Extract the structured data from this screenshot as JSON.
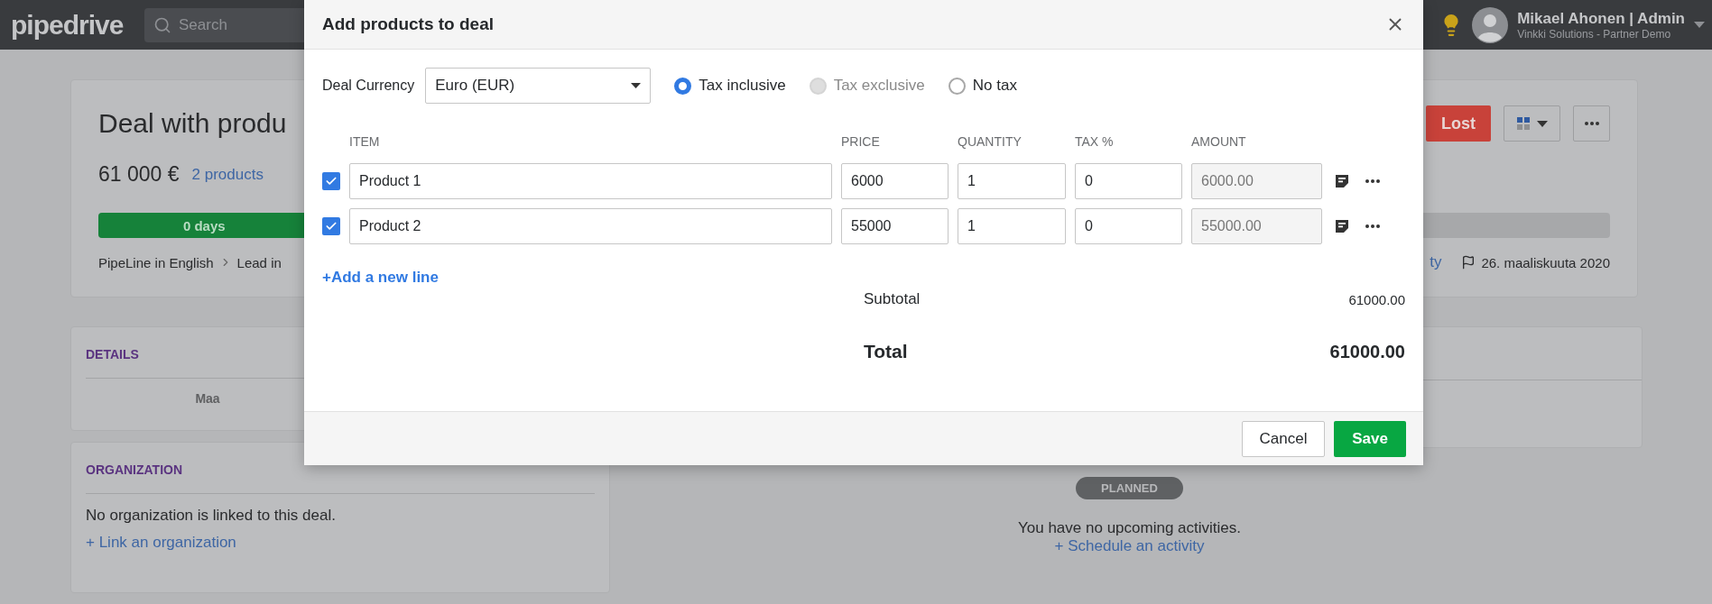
{
  "topbar": {
    "logo": "pipedrive",
    "search": {
      "placeholder": "Search"
    },
    "user": {
      "name": "Mikael Ahonen | Admin",
      "company": "Vinkki Solutions - Partner Demo"
    }
  },
  "deal": {
    "title": "Deal with produ",
    "value": "61 000 €",
    "products_link": "2 products",
    "stage": {
      "label": "0 days",
      "level": 0.14
    },
    "breadcrumb": [
      "PipeLine in English",
      "Lead in"
    ],
    "lost_button": "Lost",
    "cut_link": "ty",
    "close_date": "26. maaliskuuta 2020"
  },
  "details": {
    "heading": "DETAILS",
    "field": "Maa"
  },
  "organization": {
    "heading": "ORGANIZATION",
    "message": "No organization is linked to this deal.",
    "link": "+ Link an organization"
  },
  "activities": {
    "status": "PLANNED",
    "message": "You have no upcoming activities.",
    "link": "+ Schedule an activity"
  },
  "modal": {
    "title": "Add products to deal",
    "currency_label": "Deal Currency",
    "currency": "Euro (EUR)",
    "tax_options": [
      {
        "label": "Tax inclusive",
        "selected": true,
        "disabled": false
      },
      {
        "label": "Tax exclusive",
        "selected": false,
        "disabled": true
      },
      {
        "label": "No tax",
        "selected": false,
        "disabled": false
      }
    ],
    "columns": [
      "ITEM",
      "PRICE",
      "QUANTITY",
      "TAX %",
      "AMOUNT"
    ],
    "rows": [
      {
        "checked": true,
        "item": "Product 1",
        "price": "6000",
        "quantity": "1",
        "tax": "0",
        "amount": "6000.00"
      },
      {
        "checked": true,
        "item": "Product 2",
        "price": "55000",
        "quantity": "1",
        "tax": "0",
        "amount": "55000.00"
      }
    ],
    "add_line": "+Add a new line",
    "subtotal_label": "Subtotal",
    "subtotal": "61000.00",
    "total_label": "Total",
    "total": "61000.00",
    "cancel": "Cancel",
    "save": "Save"
  }
}
